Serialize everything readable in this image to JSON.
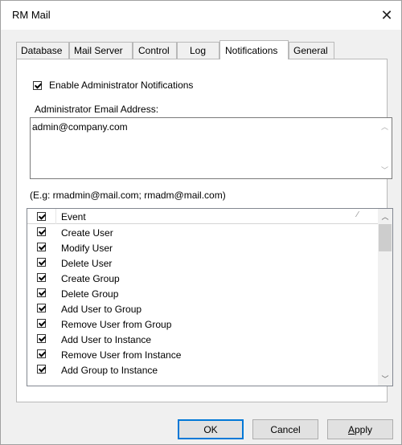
{
  "window": {
    "title": "RM Mail"
  },
  "tabs": [
    {
      "label": "Database"
    },
    {
      "label": "Mail Server"
    },
    {
      "label": "Control"
    },
    {
      "label": "Log"
    },
    {
      "label": "Notifications",
      "active": true
    },
    {
      "label": "General"
    }
  ],
  "notifications": {
    "enable_label": "Enable Administrator Notifications",
    "enable_checked": true,
    "email_label": "Administrator Email Address:",
    "email_value": "admin@company.com",
    "example": "(E.g: rmadmin@mail.com; rmadm@mail.com)",
    "list_header": "Event",
    "events": [
      {
        "label": "Create User",
        "checked": true
      },
      {
        "label": "Modify User",
        "checked": true
      },
      {
        "label": "Delete User",
        "checked": true
      },
      {
        "label": "Create Group",
        "checked": true
      },
      {
        "label": "Delete Group",
        "checked": true
      },
      {
        "label": "Add User to Group",
        "checked": true
      },
      {
        "label": "Remove User from Group",
        "checked": true
      },
      {
        "label": "Add User to Instance",
        "checked": true
      },
      {
        "label": "Remove User from Instance",
        "checked": true
      },
      {
        "label": "Add Group to Instance",
        "checked": true
      }
    ]
  },
  "buttons": {
    "ok": "OK",
    "cancel": "Cancel",
    "apply_mnemonic": "A",
    "apply_rest": "pply"
  },
  "icons": {
    "close": "close-icon",
    "sort": "sort-icon",
    "scroll_up": "chevron-up-icon",
    "scroll_down": "chevron-down-icon"
  },
  "colors": {
    "focus_border": "#0078d7",
    "dialog_bg": "#f0f0f0"
  }
}
